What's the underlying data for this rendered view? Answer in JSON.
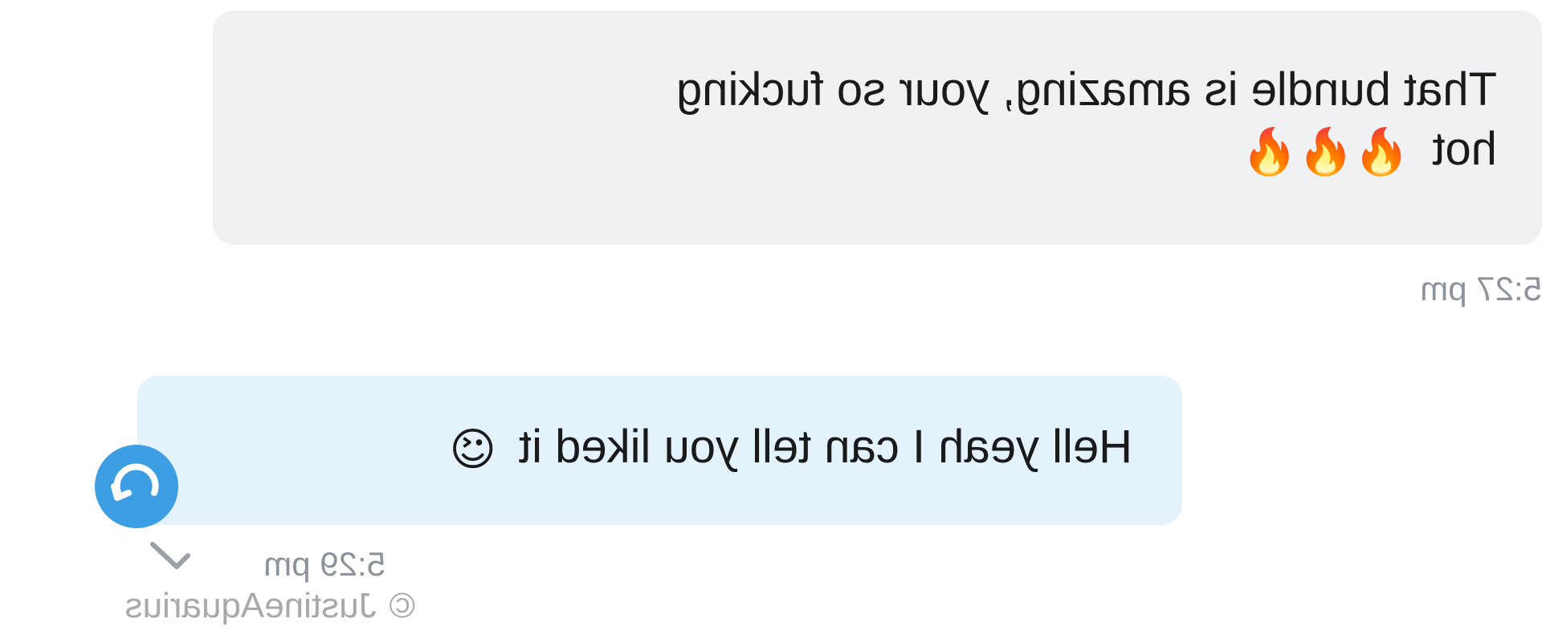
{
  "conversation": {
    "incoming": {
      "line1": "That bundle is amazing, your so fucking",
      "line2": "hot",
      "emoji": "🔥🔥🔥",
      "time": "5:27 pm"
    },
    "outgoing": {
      "text": "Hell yeah I can tell you liked it",
      "emoji": "😉",
      "time": "5:29 pm",
      "status_icon": "refresh-arrow-icon",
      "read_icon": "checkmark-icon"
    }
  },
  "watermark": {
    "symbol": "©",
    "text": "JustineAquarius"
  },
  "colors": {
    "incoming_bubble": "#f0f1f3",
    "outgoing_bubble": "#e3f2fb",
    "status_icon": "#3e9ee3",
    "timestamp": "#8c939c",
    "watermark": "#a9a9a9"
  }
}
